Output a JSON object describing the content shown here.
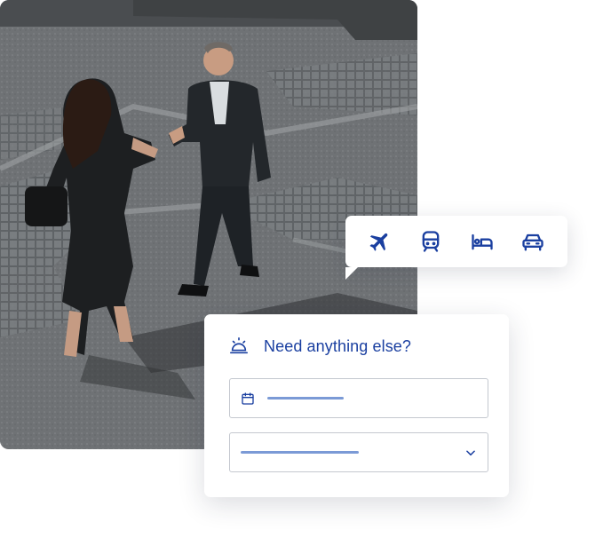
{
  "photo": {
    "scene": "business-handshake-photo"
  },
  "travel_modes": [
    {
      "icon": "plane-icon"
    },
    {
      "icon": "train-icon"
    },
    {
      "icon": "hotel-bed-icon"
    },
    {
      "icon": "car-icon"
    }
  ],
  "card": {
    "title": "Need anything else?",
    "icon": "concierge-bell-icon",
    "date_field": {
      "icon": "calendar-icon"
    },
    "select_field": {
      "icon": "chevron-down-icon"
    }
  },
  "colors": {
    "brand_blue": "#1a3fa0",
    "placeholder_bar": "#7b9ad6",
    "field_border": "#c4c8cf"
  }
}
